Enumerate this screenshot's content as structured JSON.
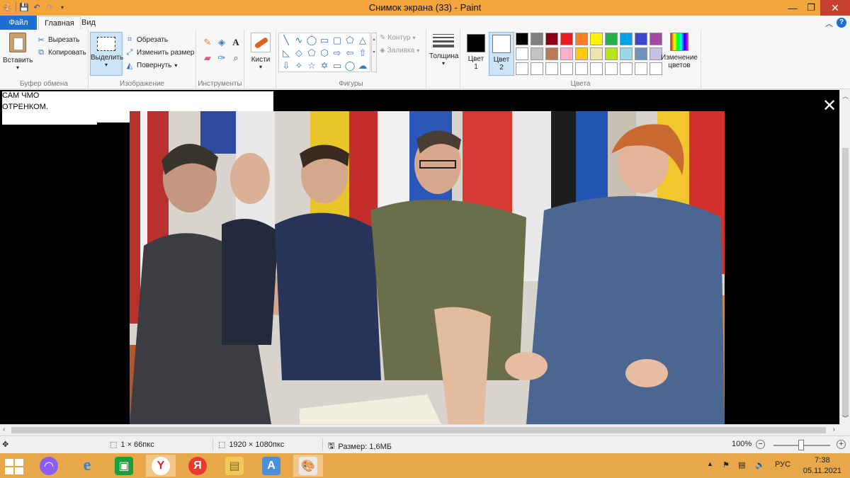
{
  "window": {
    "title": "Снимок экрана (33) - Paint",
    "controls": {
      "minimize": "—",
      "maximize": "❐",
      "close": "✕"
    }
  },
  "quick_access": {
    "icons": [
      "paint-app-icon",
      "save-icon",
      "undo-icon",
      "redo-icon",
      "customize-icon"
    ]
  },
  "tabs": {
    "file": "Файл",
    "home": "Главная",
    "view": "Вид"
  },
  "ribbon": {
    "clipboard": {
      "paste": "Вставить",
      "cut": "Вырезать",
      "copy": "Копировать",
      "group_label": "Буфер обмена"
    },
    "image": {
      "select": "Выделить",
      "crop": "Обрезать",
      "resize": "Изменить размер",
      "rotate": "Повернуть",
      "group_label": "Изображение"
    },
    "tools": {
      "group_label": "Инструменты"
    },
    "brushes": {
      "label": "Кисти"
    },
    "shapes": {
      "outline": "Контур",
      "fill": "Заливка",
      "group_label": "Фигуры"
    },
    "thickness": {
      "label": "Толщина"
    },
    "colors": {
      "color1_label": "Цвет",
      "color1_num": "1",
      "color2_label": "Цвет",
      "color2_num": "2",
      "color1": "#000000",
      "color2": "#ffffff",
      "edit_colors_line1": "Изменение",
      "edit_colors_line2": "цветов",
      "group_label": "Цвета",
      "palette": [
        "#000000",
        "#7f7f7f",
        "#880015",
        "#ed1c24",
        "#ff7f27",
        "#fff200",
        "#22b14c",
        "#00a2e8",
        "#3f48cc",
        "#a349a4",
        "#ffffff",
        "#c3c3c3",
        "#b97a57",
        "#ffaec9",
        "#ffc90e",
        "#efe4b0",
        "#b5e61d",
        "#99d9ea",
        "#7092be",
        "#c8bfe7",
        "#ffffff",
        "#ffffff",
        "#ffffff",
        "#ffffff",
        "#ffffff",
        "#ffffff",
        "#ffffff",
        "#ffffff",
        "#ffffff",
        "#ffffff"
      ]
    }
  },
  "canvas": {
    "overlay_text_line1": "САМ ЧМО",
    "overlay_text_line2": "ОТРЕНКОМ.",
    "viewer_close": "✕"
  },
  "statusbar": {
    "cursor_pos": "1 × 66пкс",
    "image_size": "1920 × 1080пкс",
    "file_size": "Размер: 1,6МБ",
    "zoom": "100%"
  },
  "taskbar": {
    "apps": [
      "alice-icon",
      "ie-icon",
      "store-icon",
      "yandex-browser-icon",
      "yandex-icon",
      "explorer-icon",
      "wordpad-icon",
      "paint-icon"
    ],
    "lang": "РУС",
    "time": "7:38",
    "date": "05.11.2021"
  }
}
